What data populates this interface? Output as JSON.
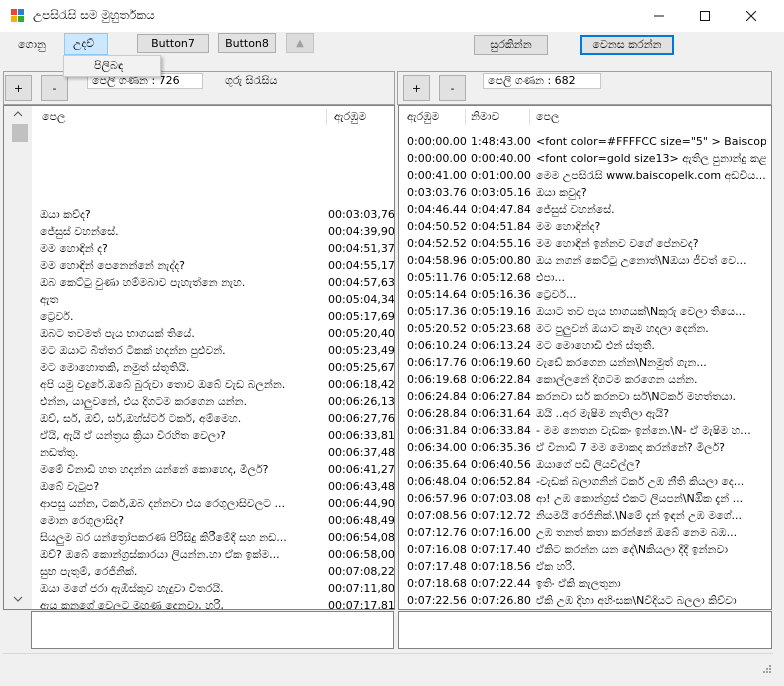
{
  "window": {
    "title": "උපසිරැසි සම මුහුර්තකය"
  },
  "menu": [
    {
      "label": "ගොනු"
    },
    {
      "label": "උදව්"
    }
  ],
  "dropdown": {
    "item": "පිලිබඳ"
  },
  "toolbar": {
    "button7": "Button7",
    "button8": "Button8",
    "up": "▲",
    "save": "සුරකින්න",
    "change": "වෙනස කරන්න"
  },
  "left": {
    "plus": "+",
    "minus": "-",
    "count": "පෙලි ගණන : 726",
    "heading": "ගුරු සිරැසිය",
    "columns": {
      "text": "පෙල",
      "start": "ඇරඹුම"
    },
    "rows": [
      {
        "text": "",
        "start": ""
      },
      {
        "text": "",
        "start": ""
      },
      {
        "text": "",
        "start": ""
      },
      {
        "text": "ඔයා කව්ද?",
        "start": "00:03:03,768"
      },
      {
        "text": "ජේසුස් වහන්සේ.",
        "start": "00:04:39,906"
      },
      {
        "text": "මම හොඳින් ද?",
        "start": "00:04:51,375"
      },
      {
        "text": "මම හොඳින් පෙනෙන්නේ නැද්ද?",
        "start": "00:04:55,171"
      },
      {
        "text": "ඔබ කෙට්ටු වුණා හම්මබාව පැහැත්නෙ නැහ.",
        "start": "00:04:57,632"
      },
      {
        "text": "ඇත",
        "start": "00:05:04,347"
      },
      {
        "text": "ට්‍රෙවර්.",
        "start": "00:05:17,693"
      },
      {
        "text": "ඔබට තවමත් පැය භාගයක් තියේ.",
        "start": "00:05:20,404"
      },
      {
        "text": "මට ඔයාට බිත්තර ටිකක් හදන්න පුළුවන්.",
        "start": "00:05:23,491"
      },
      {
        "text": "මට මොහොතකි, නමුත් ස්තූතියි.",
        "start": "00:05:25,677"
      },
      {
        "text": "අපි යමු වදුරේ.ඔබේ බුරුවා තොව ඔබේ වැඩ බලන්න.",
        "start": "00:06:18,421"
      },
      {
        "text": "එන්න, යාලුවනේ, එය දිගටම කරගෙන යන්න.",
        "start": "00:06:26,137"
      },
      {
        "text": "ඔව්, සර්, ඔව්, සර්,ඔහ්ස්ටර් ටකර්, අම්මෙහ.",
        "start": "00:06:27,763"
      },
      {
        "text": "ඒයි, ඇයි ඒ යන්ත්‍රය ක්‍රියා විරහිත වෙලා?",
        "start": "00:06:33,811"
      },
      {
        "text": "නඩත්තු.",
        "start": "00:06:37,481"
      },
      {
        "text": "මමේ විනාඩි හත හදන්න යන්නේ කොහෙද, මිලර්?",
        "start": "00:06:41,277"
      },
      {
        "text": "ඔබේ වැටුප?",
        "start": "00:06:43,487"
      },
      {
        "text": "ආපසු යන්න, ටකර්,ඔබ දන්නවා එය රෙගුලාසිවලට ...",
        "start": "00:06:44,906"
      },
      {
        "text": "මොන රෙගුලාසිද?",
        "start": "00:06:48,492"
      },
      {
        "text": "සියලුම බර යන්ත්‍රෝපකරණ පිරිසිදු කිරීමේදී සහ නඩ...",
        "start": "00:06:54,081"
      },
      {
        "text": "ඔව්?  ඔබේ කොන්ග්‍රස්කාරයා ලියන්න.හා ඒක ඉක්ම...",
        "start": "00:06:58,004"
      },
      {
        "text": "සුභ පැතුම්, රෙජිනික්.",
        "start": "00:07:08,220"
      },
      {
        "text": "ඔයා මගේ ජරා ඇඹිස්කුව හැදුවා විතරයි.",
        "start": "00:07:11,807"
      },
      {
        "text": "ඇය කනුගේ වෙලට මුහුණ දෙනවා, හරි,",
        "start": "00:07:17,813"
      },
      {
        "text": "ඔහු ඇයට කියනවා, ඔබ දන්නවා,\"බඩා\" මේක, \"බඩා...",
        "start": "00:07:19,231"
      }
    ]
  },
  "right": {
    "plus": "+",
    "minus": "-",
    "count": "පෙලි ගණන : 682",
    "columns": {
      "start": "ඇරඹුම",
      "end": "නිමාව",
      "text": "පෙල"
    },
    "rows": [
      {
        "start": "0:00:00.00",
        "end": "1:48:43.00",
        "text": "<font color=#FFFFCC size=\"5\" > Baiscopelk.co..."
      },
      {
        "start": "0:00:00.00",
        "end": "0:00:40.00",
        "text": "<font color=gold size13> ඇතිල පුනාන්දු කළ උ..."
      },
      {
        "start": "0:00:41.00",
        "end": "0:01:00.00",
        "text": "මෙම උපසිරැසි www.baiscopelk.com අඩවිය..."
      },
      {
        "start": "0:03:03.76",
        "end": "0:03:05.16",
        "text": "ඔයා කවුද?"
      },
      {
        "start": "0:04:46.44",
        "end": "0:04:47.84",
        "text": "ජේසුස් වහන්සේ."
      },
      {
        "start": "0:04:50.52",
        "end": "0:04:51.84",
        "text": "මම හොඳින්ද?"
      },
      {
        "start": "0:04:52.52",
        "end": "0:04:55.16",
        "text": "මම හොඳින් ඉන්නව වගේ පේනවද?"
      },
      {
        "start": "0:04:58.96",
        "end": "0:05:00.80",
        "text": "ඔය නගන් කෙට්ටු උනොත්\\Nඔයා ජීවත් වෙ..."
      },
      {
        "start": "0:05:11.76",
        "end": "0:05:12.68",
        "text": "එපා..."
      },
      {
        "start": "0:05:14.64",
        "end": "0:05:16.36",
        "text": "ට්‍රෙවර්..."
      },
      {
        "start": "0:05:17.36",
        "end": "0:05:19.16",
        "text": "ඔයාට තව පැය භාගයක්\\Nකුරු වෙලා තියෙ..."
      },
      {
        "start": "0:05:20.52",
        "end": "0:05:23.68",
        "text": "මට පුලුවන් ඔයාට කෑම හදලා දෙන්න."
      },
      {
        "start": "0:06:10.24",
        "end": "0:06:13.24",
        "text": "මට මොහොඩී එන් ස්තූතී."
      },
      {
        "start": "0:06:17.76",
        "end": "0:06:19.60",
        "text": "වැඩේ කරගෙන යන්න\\Nනමුත් ගැන..."
      },
      {
        "start": "0:06:19.68",
        "end": "0:06:22.84",
        "text": "කොල්ලනේ දිගටම කරගෙන යන්න."
      },
      {
        "start": "0:06:24.84",
        "end": "0:06:27.84",
        "text": "කරනවා සර් කරනවා සර්\\Nටකර් මහත්තයා."
      },
      {
        "start": "0:06:28.84",
        "end": "0:06:31.64",
        "text": "ඔයි ..අර මැෂිම නැතිලා ඇයි?"
      },
      {
        "start": "0:06:31.84",
        "end": "0:06:33.84",
        "text": "- මම නෙතන වැඩකං ඉන්නෙ.\\N- ඒ මැෂිම හ..."
      },
      {
        "start": "0:06:34.00",
        "end": "0:06:35.36",
        "text": "ඒ විනාඩි 7 මම මොකද කරන්නේ? මිලර්?"
      },
      {
        "start": "0:06:35.64",
        "end": "0:06:40.56",
        "text": "ඔයාගේ පඩි ලියවිල්ල?"
      },
      {
        "start": "0:06:48.04",
        "end": "0:06:52.84",
        "text": "-වැඩක් බලාගනින් ටකර් උඹ නීති කියලා දෙ..."
      },
      {
        "start": "0:06:57.96",
        "end": "0:07:03.08",
        "text": "ආ! උඹ කොන්ග්‍රස් එකට ලියපන්\\Nඔික දැන් ..."
      },
      {
        "start": "0:07:08.56",
        "end": "0:07:12.72",
        "text": "නියමයි රෙජිනික්.\\Nමේ දැන් ඉඳන් උඹ මගේ..."
      },
      {
        "start": "0:07:12.76",
        "end": "0:07:16.00",
        "text": "උඹ තනත් කතා කරන්නේ ඔබේ නෙම බඹ..."
      },
      {
        "start": "0:07:16.08",
        "end": "0:07:17.40",
        "text": "ඒකිට කරන්න යන දේ\\Nකියලා දීදී ඉන්නවා"
      },
      {
        "start": "0:07:17.48",
        "end": "0:07:18.56",
        "text": "ඒක හරි."
      },
      {
        "start": "0:07:18.68",
        "end": "0:07:22.44",
        "text": "ඉතිං ඒකි කැලතුනා"
      },
      {
        "start": "0:07:22.56",
        "end": "0:07:26.80",
        "text": "ඒකි උඹ දිහා අහිංසක\\Nවිදියට බලලා කිව්වා"
      },
      {
        "start": "",
        "end": "",
        "text": "ඒක හොඳ අදහසක් එන්\\Nමට අරකක් නෑ ..."
      }
    ]
  },
  "icons": {
    "app": "app-icon",
    "minimize": "minimize-icon",
    "maximize": "maximize-icon",
    "close": "close-icon",
    "scroll_up": "chevron-up-icon",
    "scroll_down": "chevron-down-icon"
  }
}
